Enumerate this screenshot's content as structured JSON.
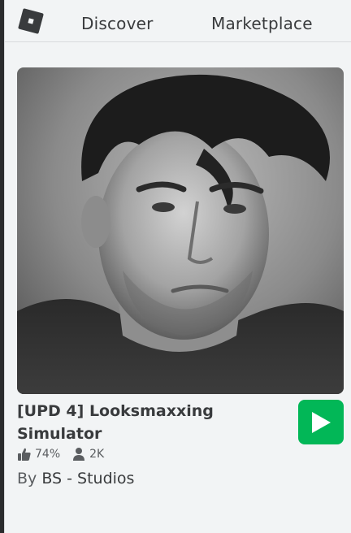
{
  "nav": {
    "discover_label": "Discover",
    "marketplace_label": "Marketplace"
  },
  "game": {
    "title": "[UPD 4] Looksmaxxing Simulator",
    "rating": "74%",
    "players": "2K",
    "creator_prefix": "By",
    "creator_name": "BS - Studios"
  },
  "colors": {
    "play_button": "#02b757",
    "text_primary": "#393b3d",
    "background": "#f2f4f5"
  },
  "icons": [
    "roblox-logo-icon",
    "thumbs-up-icon",
    "person-icon",
    "play-icon"
  ]
}
